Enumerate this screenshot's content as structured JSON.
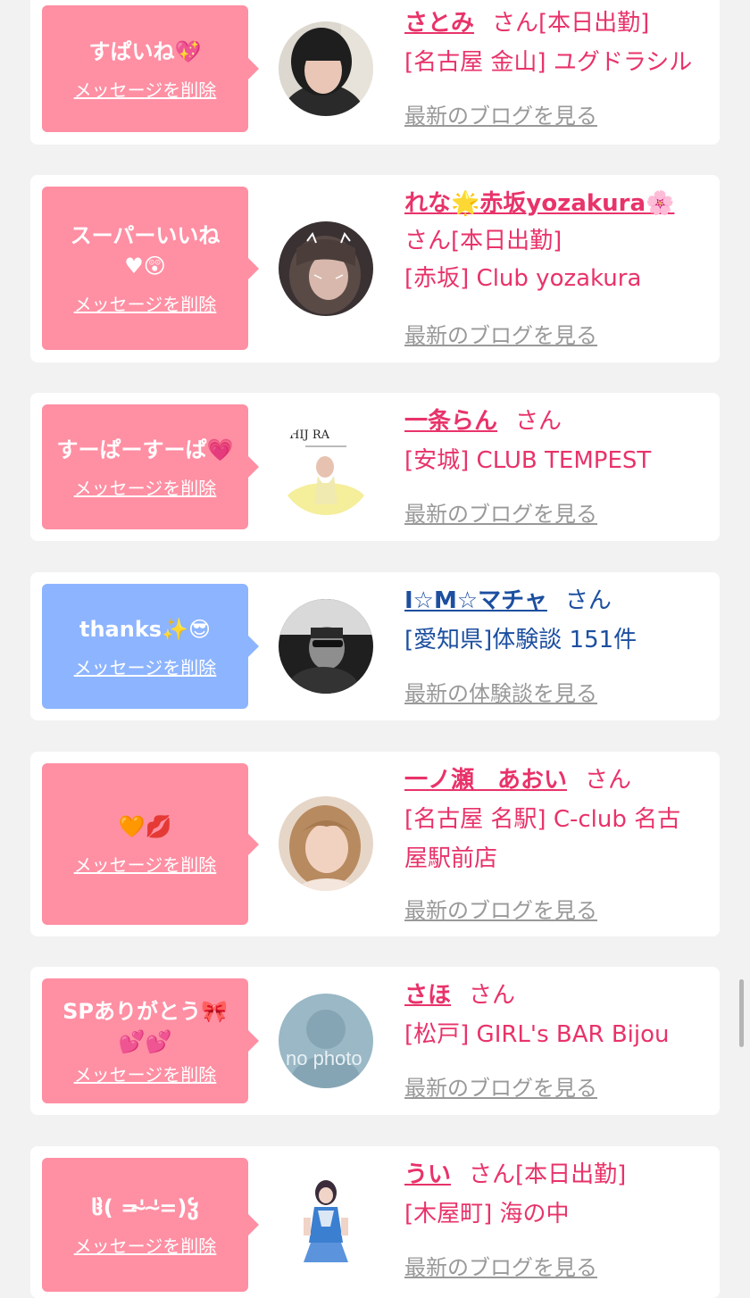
{
  "delete_label": "メッセージを削除",
  "colors": {
    "pink_bubble": "#ff8fa3",
    "blue_bubble": "#8db4ff",
    "name_pink": "#e8336a",
    "name_blue": "#1c4fa0"
  },
  "cards": [
    {
      "message": "すぱいね💖",
      "name": "さとみ",
      "san": "さん",
      "status": "[本日出勤]",
      "shop": "[名古屋 金山] ユグドラシル",
      "link": "最新のブログを見る",
      "avatar_icon": "woman-dark-hair-photo"
    },
    {
      "message": "スーパーいいね♥😲",
      "name": "れな🌟赤坂yozakura🌸",
      "san": "さん",
      "status": "[本日出勤]",
      "shop": "[赤坂] Club yozakura",
      "link": "最新のブログを見る",
      "avatar_icon": "woman-cat-filter-photo"
    },
    {
      "message": "すーぱーすーぱ💗",
      "name": "一条らん",
      "san": "さん",
      "status": "",
      "shop": "[安城] CLUB TEMPEST",
      "link": "最新のブログを見る",
      "avatar_icon": "magazine-cover-photo",
      "cover_text": "HIJ RA"
    },
    {
      "message": "thanks✨😎",
      "name": "I☆M☆マチャ",
      "san": "さん",
      "status": "",
      "shop": "[愛知県]体験談 151件",
      "link": "最新の体験談を見る",
      "avatar_icon": "man-sunglasses-photo"
    },
    {
      "message": "🧡💋",
      "name": "一ノ瀬　あおい",
      "san": "さん",
      "status": "",
      "shop": "[名古屋 名駅] C-club 名古屋駅前店",
      "link": "最新のブログを見る",
      "avatar_icon": "woman-blonde-photo"
    },
    {
      "message": "SPありがとう🎀💕💕",
      "name": "さほ",
      "san": "さん",
      "status": "",
      "shop": "[松戸] GIRL's BAR Bijou",
      "link": "最新のブログを見る",
      "avatar_icon": "no-photo-placeholder",
      "placeholder_text": "no photo"
    },
    {
      "message": "ჱ̒( ='̴ '̴=)ჴ",
      "name": "うい",
      "san": "さん",
      "status": "[本日出勤]",
      "shop": "[木屋町] 海の中",
      "link": "最新のブログを見る",
      "avatar_icon": "idol-costume-photo"
    }
  ]
}
